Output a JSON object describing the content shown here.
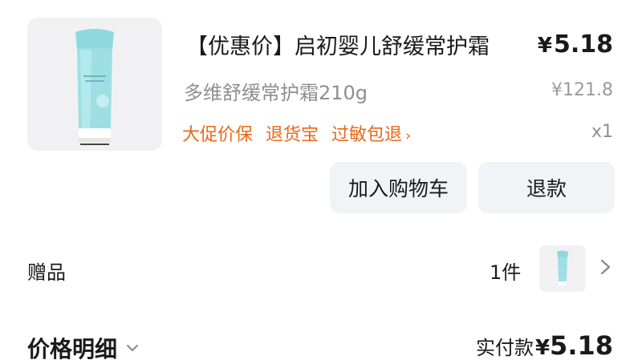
{
  "product": {
    "title": "【优惠价】启初婴儿舒缓常护霜",
    "price_symbol": "¥",
    "price": "5.18",
    "spec": "多维舒缓常护霜210g",
    "original_price": "¥121.8",
    "tags": [
      "大促价保",
      "退货宝",
      "过敏包退"
    ],
    "tag_arrow": "›",
    "quantity": "x1",
    "image_icon": "product-tube-image"
  },
  "actions": {
    "add_to_cart": "加入购物车",
    "refund": "退款"
  },
  "gift": {
    "label": "赠品",
    "count": "1件",
    "icon": "chevron-right-icon"
  },
  "summary": {
    "detail_label": "价格明细",
    "detail_icon": "chevron-down-icon",
    "paid_label": "实付款",
    "paid_symbol": "¥",
    "paid_amount": "5.18"
  },
  "colors": {
    "accent_orange": "#e8691a",
    "button_bg": "#f1f3f7",
    "product_tube": "#8fd8de"
  }
}
